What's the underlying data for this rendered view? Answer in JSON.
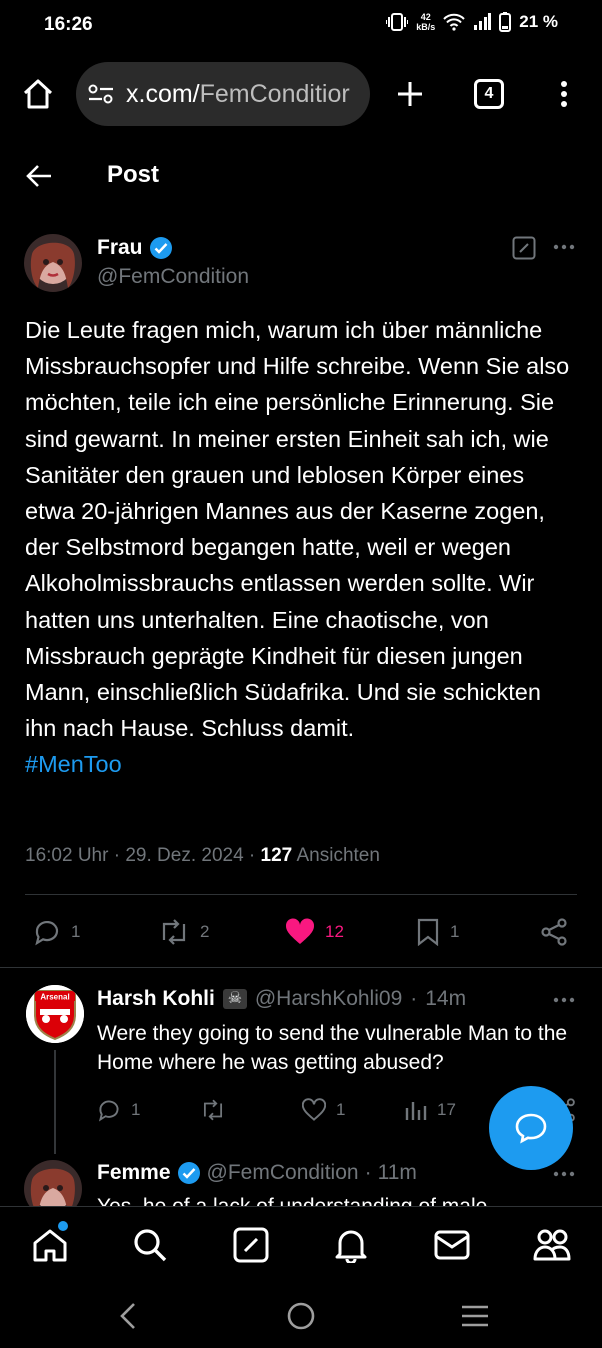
{
  "status_bar": {
    "time": "16:26",
    "net_speed_value": "42",
    "net_speed_unit": "kB/s",
    "battery": "21 %"
  },
  "browser": {
    "url_domain": "x.com/",
    "url_path": "FemConditior",
    "tab_count": "4"
  },
  "header": {
    "title": "Post"
  },
  "tweet": {
    "author_name": "Frau",
    "author_handle": "@FemCondition",
    "body": "Die Leute fragen mich, warum ich über männliche Missbrauchsopfer und Hilfe schreibe. Wenn Sie also möchten, teile ich eine persönliche Erinnerung. Sie sind gewarnt. In meiner ersten Einheit sah ich, wie Sanitäter den grauen und leblosen Körper eines etwa 20-jährigen Mannes aus der Kaserne zogen, der Selbstmord begangen hatte, weil er wegen Alkoholmissbrauchs entlassen werden sollte. Wir hatten uns unterhalten. Eine chaotische, von Missbrauch geprägte Kindheit für diesen jungen Mann, einschließlich Südafrika. Und sie schickten ihn nach Hause. Schluss damit.",
    "hashtag": "#MenToo",
    "time": "16:02 Uhr",
    "date": "29. Dez. 2024",
    "views_count": "127",
    "views_label": "Ansichten",
    "replies": "1",
    "reposts": "2",
    "likes": "12",
    "bookmarks": "1",
    "like_color": "#f91880"
  },
  "reply1": {
    "avatar_text": "Arsenal",
    "author_name": "Harsh Kohli",
    "author_handle": "@HarshKohli09",
    "time": "14m",
    "text": "Were they going to send the vulnerable Man to the Home where he was getting abused?",
    "replies": "1",
    "likes": "1",
    "views": "17"
  },
  "reply2": {
    "author_name": "Femme",
    "author_handle": "@FemCondition",
    "time": "11m",
    "text": "Yes, he of a lack of understanding of male"
  },
  "colors": {
    "accent": "#1d9bf0",
    "muted": "#71767b",
    "divider": "#2f3336"
  }
}
